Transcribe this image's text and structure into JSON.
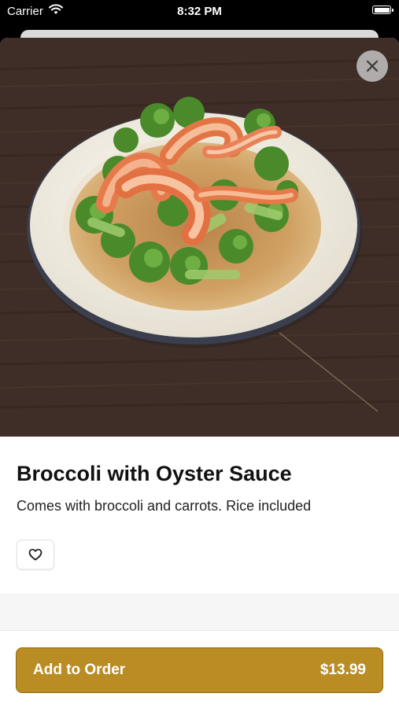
{
  "status_bar": {
    "carrier": "Carrier",
    "time": "8:32 PM"
  },
  "item": {
    "name": "Broccoli with Oyster Sauce",
    "description": "Comes with broccoli and carrots. Rice included",
    "image_icon": "shrimp-broccoli-plate-photo"
  },
  "actions": {
    "close_icon": "close-icon",
    "favorite_icon": "heart-icon"
  },
  "order_button": {
    "label": "Add to Order",
    "price": "$13.99"
  },
  "colors": {
    "accent": "#b98d23",
    "text": "#111111"
  }
}
